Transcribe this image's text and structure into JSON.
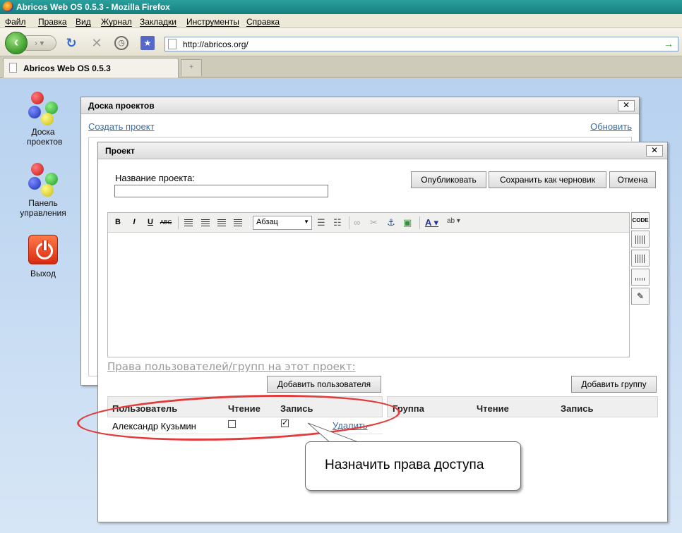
{
  "browser": {
    "title": "Abricos Web OS 0.5.3 - Mozilla Firefox",
    "menu": [
      "Файл",
      "Правка",
      "Вид",
      "Журнал",
      "Закладки",
      "Инструменты",
      "Справка"
    ],
    "url": "http://abricos.org/",
    "tab_label": "Abricos Web OS 0.5.3"
  },
  "desktop": {
    "icons": [
      {
        "label": "Доска проектов",
        "icon": "molecule-icon"
      },
      {
        "label": "Панель управления",
        "icon": "molecule-icon"
      },
      {
        "label": "Выход",
        "icon": "power-icon"
      }
    ]
  },
  "board_window": {
    "title": "Доска проектов",
    "create_link": "Создать проект",
    "refresh_link": "Обновить",
    "close": "✕"
  },
  "project_window": {
    "title": "Проект",
    "close": "✕",
    "name_label": "Название проекта:",
    "name_value": "",
    "buttons": {
      "publish": "Опубликовать",
      "save_draft": "Сохранить как черновик",
      "cancel": "Отмена"
    },
    "editor": {
      "format_value": "Абзац",
      "side_buttons": [
        "CODE"
      ]
    },
    "rights_title": "Права пользователей/групп на этот проект:",
    "add_user_button": "Добавить пользователя",
    "add_group_button": "Добавить группу",
    "users_table": {
      "headers": [
        "Пользователь",
        "Чтение",
        "Запись"
      ],
      "rows": [
        {
          "user": "Александр Кузьмин",
          "read": false,
          "write": true,
          "action": "Удалить"
        }
      ]
    },
    "groups_table": {
      "headers": [
        "Группа",
        "Чтение",
        "Запись"
      ]
    }
  },
  "annotation": {
    "callout_text": "Назначить права доступа",
    "highlight_color": "#e23b3b"
  }
}
